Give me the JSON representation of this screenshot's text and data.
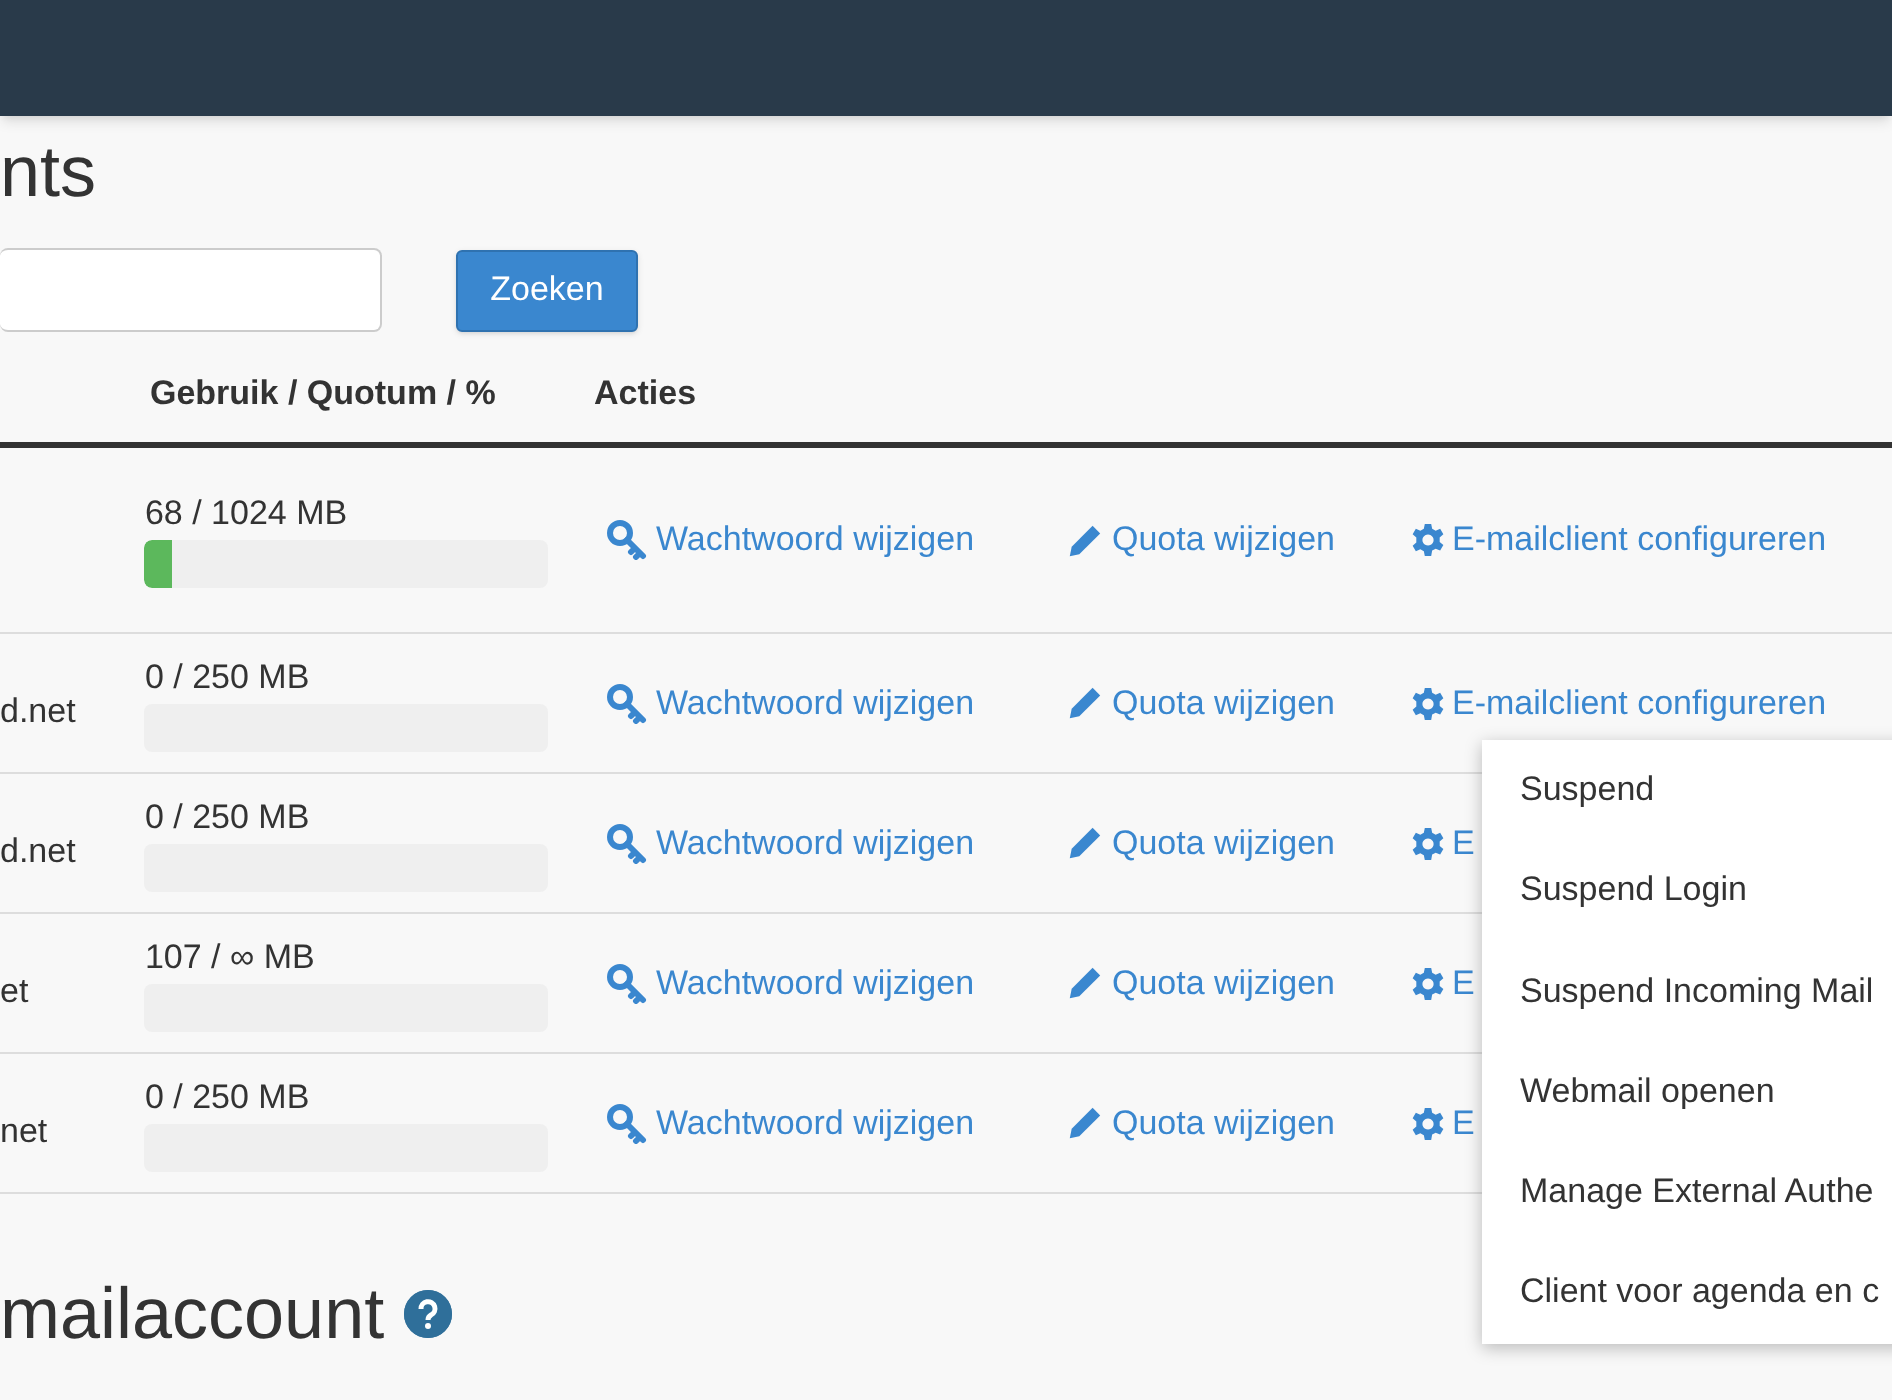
{
  "page_title": "nts",
  "search": {
    "button": "Zoeken"
  },
  "table": {
    "columns": [
      "Gebruik / Quotum / %",
      "Acties"
    ],
    "rows": [
      {
        "usage": "68 / 1024 MB",
        "level": 0.066,
        "actions": [
          {
            "kind": "password",
            "label": "Wachtwoord wijzigen"
          },
          {
            "kind": "quota",
            "label": "Quota wijzigen"
          },
          {
            "kind": "configure",
            "label": "E-mailclient configureren"
          }
        ]
      },
      {
        "account": "d.net",
        "usage": "0 / 250 MB",
        "level": 0,
        "actions": [
          {
            "kind": "password",
            "label": "Wachtwoord wijzigen"
          },
          {
            "kind": "quota",
            "label": "Quota wijzigen"
          },
          {
            "kind": "configure",
            "label": "E-mailclient configureren"
          }
        ]
      },
      {
        "account": "d.net",
        "usage": "0 / 250 MB",
        "level": 0,
        "actions": [
          {
            "kind": "password",
            "label": "Wachtwoord wijzigen"
          },
          {
            "kind": "quota",
            "label": "Quota wijzigen"
          },
          {
            "kind": "configure",
            "label": "E"
          }
        ]
      },
      {
        "account": "et",
        "usage": "107 / ∞ MB",
        "level": 0,
        "actions": [
          {
            "kind": "password",
            "label": "Wachtwoord wijzigen"
          },
          {
            "kind": "quota",
            "label": "Quota wijzigen"
          },
          {
            "kind": "configure",
            "label": "E"
          }
        ]
      },
      {
        "account": "net",
        "usage": "0 / 250 MB",
        "level": 0,
        "actions": [
          {
            "kind": "password",
            "label": "Wachtwoord wijzigen"
          },
          {
            "kind": "quota",
            "label": "Quota wijzigen"
          },
          {
            "kind": "configure",
            "label": "E"
          }
        ]
      }
    ]
  },
  "dropdown_menu": [
    "Suspend",
    "Suspend Login",
    "Suspend Incoming Mail",
    "Webmail openen",
    "Manage External Authe",
    "Client voor agenda en c"
  ],
  "section_heading": "mailaccount"
}
